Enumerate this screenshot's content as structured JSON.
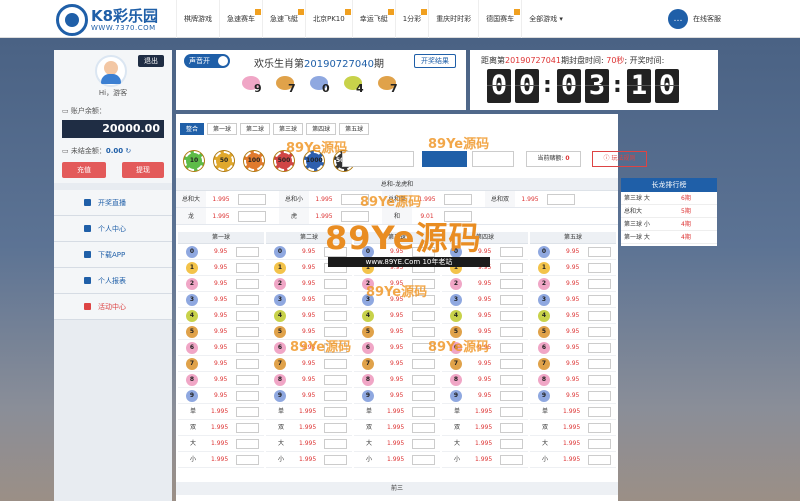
{
  "brand": {
    "title": "K8彩乐园",
    "url": "WWW.7370.COM"
  },
  "nav": [
    "棋牌游戏",
    "急速赛车",
    "急速飞艇",
    "北京PK10",
    "幸运飞艇",
    "1分彩",
    "重庆时时彩",
    "德国赛车",
    "全部游戏 ▾"
  ],
  "service": {
    "icon": "chat-icon",
    "label": "在线客服"
  },
  "user": {
    "logout": "退出",
    "greeting": "Hi，游客",
    "balance_label": "账户余额：",
    "balance": "20000.00",
    "pending_label": "未结金额：",
    "pending": "0.00",
    "deposit": "充值",
    "withdraw": "提现"
  },
  "menu": [
    "开奖直播",
    "个人中心",
    "下载APP",
    "个人报表",
    "活动中心"
  ],
  "header": {
    "sound": "声音开",
    "issue_prefix": "欢乐生肖第",
    "issue": "20190727040",
    "issue_suffix": "期",
    "results_button": "开奖结果",
    "result_numbers": [
      "9",
      "7",
      "0",
      "4",
      "7"
    ]
  },
  "countdown": {
    "prefix": "距离第",
    "issue": "20190727041",
    "mid": "期封盘时间: ",
    "close_time": "70秒",
    "suffix": "; 开奖时间:",
    "digits": [
      "0",
      "0",
      "0",
      "3",
      "1",
      "0"
    ]
  },
  "tabs": [
    "整合",
    "第一球",
    "第二球",
    "第三球",
    "第四球",
    "第五球"
  ],
  "chips": [
    "10",
    "50",
    "100",
    "500",
    "1000",
    "5000"
  ],
  "current_stake_label": "当前赌额:",
  "current_stake": "0",
  "rules_button": "玩法规则",
  "sum": {
    "title": "总和-龙虎和",
    "rows": [
      [
        {
          "label": "总和大",
          "odds": "1.995"
        },
        {
          "label": "总和小",
          "odds": "1.995"
        },
        {
          "label": "总和单",
          "odds": "1.995"
        },
        {
          "label": "总和双",
          "odds": "1.995"
        }
      ],
      [
        {
          "label": "龙",
          "odds": "1.995"
        },
        {
          "label": "虎",
          "odds": "1.995"
        },
        {
          "label": "和",
          "odds": "9.01"
        }
      ]
    ]
  },
  "balls": {
    "headers": [
      "第一球",
      "第二球",
      "第三球",
      "第四球",
      "第五球"
    ],
    "numbers": [
      "0",
      "1",
      "2",
      "3",
      "4",
      "5",
      "6",
      "7",
      "8",
      "9"
    ],
    "number_odds": "9.95",
    "extras": [
      {
        "label": "单",
        "odds": "1.995"
      },
      {
        "label": "双",
        "odds": "1.995"
      },
      {
        "label": "大",
        "odds": "1.995"
      },
      {
        "label": "小",
        "odds": "1.995"
      }
    ]
  },
  "lower_title": "前三",
  "rank": {
    "title": "长龙排行榜",
    "rows": [
      {
        "name": "第三球 大",
        "value": "6期"
      },
      {
        "name": "总和大",
        "value": "5期"
      },
      {
        "name": "第三球 小",
        "value": "4期"
      },
      {
        "name": "第一球 大",
        "value": "4期"
      }
    ]
  },
  "watermark": {
    "big": "89Ye源码",
    "url": "www.89YE.Com",
    "tag": "10年老站",
    "small": "89Ye源码"
  },
  "colors": {
    "brand": "#1f5fa8",
    "accent_red": "#d33",
    "panel_dark": "#1f2d44"
  }
}
